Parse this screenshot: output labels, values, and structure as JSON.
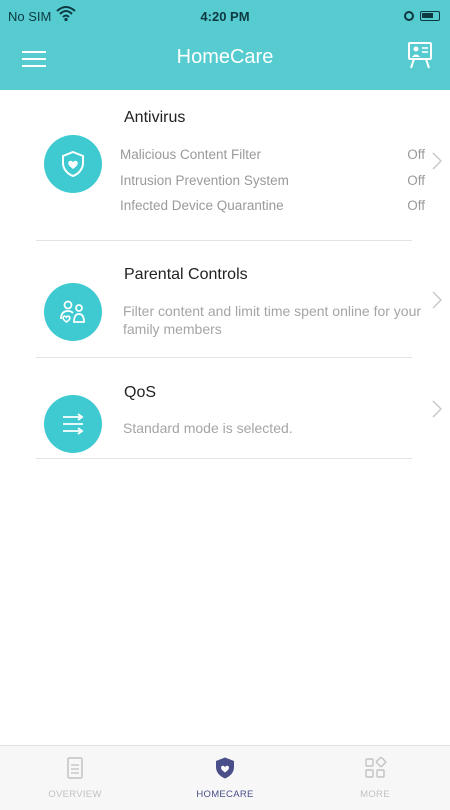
{
  "status_bar": {
    "carrier": "No SIM",
    "time": "4:20 PM"
  },
  "header": {
    "title": "HomeCare"
  },
  "antivirus": {
    "title": "Antivirus",
    "features": [
      {
        "label": "Malicious Content Filter",
        "value": "Off"
      },
      {
        "label": "Intrusion Prevention System",
        "value": "Off"
      },
      {
        "label": "Infected Device Quarantine",
        "value": "Off"
      }
    ]
  },
  "parental_controls": {
    "title": "Parental Controls",
    "description": "Filter content and limit time spent online for your family members"
  },
  "qos": {
    "title": "QoS",
    "description": "Standard mode is selected."
  },
  "tabs": [
    {
      "label": "OVERVIEW",
      "active": false
    },
    {
      "label": "HOMECARE",
      "active": true
    },
    {
      "label": "MORE",
      "active": false
    }
  ],
  "colors": {
    "header": "#56cbd0",
    "accent": "#3fcad2",
    "active_tab": "#4a4f8a",
    "muted": "#9a9a9a"
  }
}
